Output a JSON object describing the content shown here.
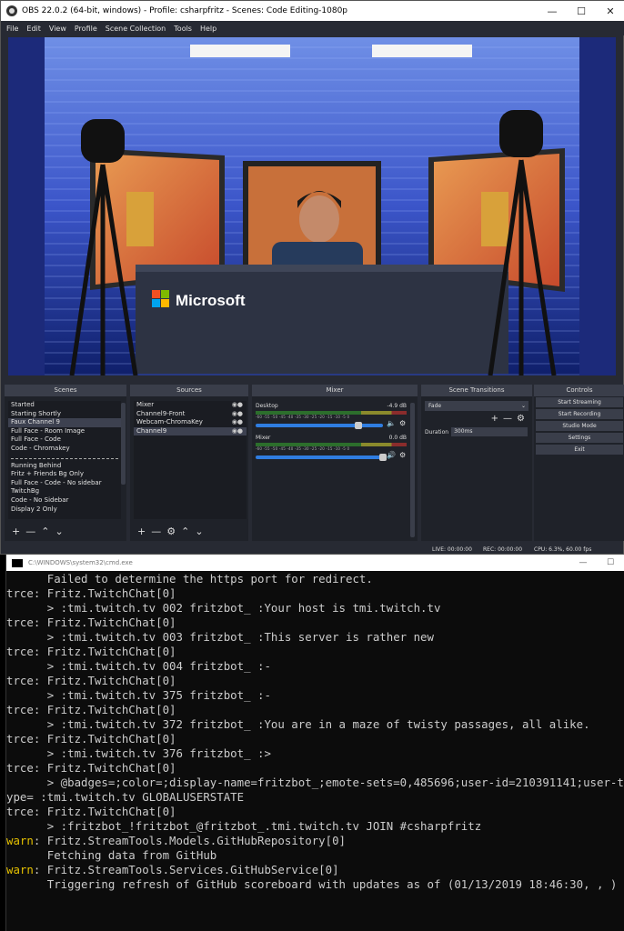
{
  "obs": {
    "title": "OBS 22.0.2 (64-bit, windows) - Profile: csharpfritz - Scenes: Code Editing-1080p",
    "menu": [
      "File",
      "Edit",
      "View",
      "Profile",
      "Scene Collection",
      "Tools",
      "Help"
    ],
    "preview": {
      "logo_text": "Microsoft"
    },
    "docks": {
      "scenes": {
        "title": "Scenes",
        "items": [
          "Started",
          "Starting Shortly",
          "Faux Channel 9",
          "Full Face - Room Image",
          "Full Face - Code",
          "Code - Chromakey"
        ],
        "items2": [
          "Running Behind",
          "Fritz + Friends Bg Only",
          "Full Face - Code - No sidebar",
          "TwitchBg",
          "Code - No Sidebar",
          "Display 2 Only"
        ],
        "selected": "Faux Channel 9"
      },
      "sources": {
        "title": "Sources",
        "items": [
          "Mixer",
          "Channel9-Front",
          "Webcam-ChromaKey",
          "Channel9"
        ]
      },
      "mixer": {
        "title": "Mixer",
        "tracks": [
          {
            "name": "Desktop",
            "db": "-4.9 dB",
            "level": 0.78
          },
          {
            "name": "Mixer",
            "db": "0.0 dB",
            "level": 0.97
          }
        ],
        "ticks": "-60 -55 -50 -45 -40 -35 -30 -25 -20 -15 -10 -5 0"
      },
      "transitions": {
        "title": "Scene Transitions",
        "selected": "Fade",
        "duration_label": "Duration",
        "duration": "300ms"
      },
      "controls": {
        "title": "Controls",
        "buttons": [
          "Start Streaming",
          "Start Recording",
          "Studio Mode",
          "Settings",
          "Exit"
        ]
      }
    },
    "status": {
      "live": "LIVE: 00:00:00",
      "rec": "REC: 00:00:00",
      "cpu": "CPU: 6.3%, 60.00 fps"
    }
  },
  "cmd": {
    "title": "C:\\WINDOWS\\system32\\cmd.exe",
    "lines": [
      {
        "l": "",
        "t": "      Failed to determine the https port for redirect."
      },
      {
        "l": "trce",
        "t": ": Fritz.TwitchChat[0]"
      },
      {
        "l": "",
        "t": "      > :tmi.twitch.tv 002 fritzbot_ :Your host is tmi.twitch.tv"
      },
      {
        "l": "trce",
        "t": ": Fritz.TwitchChat[0]"
      },
      {
        "l": "",
        "t": "      > :tmi.twitch.tv 003 fritzbot_ :This server is rather new"
      },
      {
        "l": "trce",
        "t": ": Fritz.TwitchChat[0]"
      },
      {
        "l": "",
        "t": "      > :tmi.twitch.tv 004 fritzbot_ :-"
      },
      {
        "l": "trce",
        "t": ": Fritz.TwitchChat[0]"
      },
      {
        "l": "",
        "t": "      > :tmi.twitch.tv 375 fritzbot_ :-"
      },
      {
        "l": "trce",
        "t": ": Fritz.TwitchChat[0]"
      },
      {
        "l": "",
        "t": "      > :tmi.twitch.tv 372 fritzbot_ :You are in a maze of twisty passages, all alike."
      },
      {
        "l": "trce",
        "t": ": Fritz.TwitchChat[0]"
      },
      {
        "l": "",
        "t": "      > :tmi.twitch.tv 376 fritzbot_ :>"
      },
      {
        "l": "trce",
        "t": ": Fritz.TwitchChat[0]"
      },
      {
        "l": "",
        "t": "      > @badges=;color=;display-name=fritzbot_;emote-sets=0,485696;user-id=210391141;user-t"
      },
      {
        "l": "",
        "t": "ype= :tmi.twitch.tv GLOBALUSERSTATE"
      },
      {
        "l": "trce",
        "t": ": Fritz.TwitchChat[0]"
      },
      {
        "l": "",
        "t": "      > :fritzbot_!fritzbot_@fritzbot_.tmi.twitch.tv JOIN #csharpfritz"
      },
      {
        "l": "warn",
        "t": ": Fritz.StreamTools.Models.GitHubRepository[0]"
      },
      {
        "l": "",
        "t": "      Fetching data from GitHub"
      },
      {
        "l": "warn",
        "t": ": Fritz.StreamTools.Services.GitHubService[0]"
      },
      {
        "l": "",
        "t": "      Triggering refresh of GitHub scoreboard with updates as of (01/13/2019 18:46:30, , )"
      }
    ]
  },
  "colors": {
    "obs_bg": "#272a33",
    "accent_slider": "#2f7de1",
    "warn": "#e5c100"
  }
}
